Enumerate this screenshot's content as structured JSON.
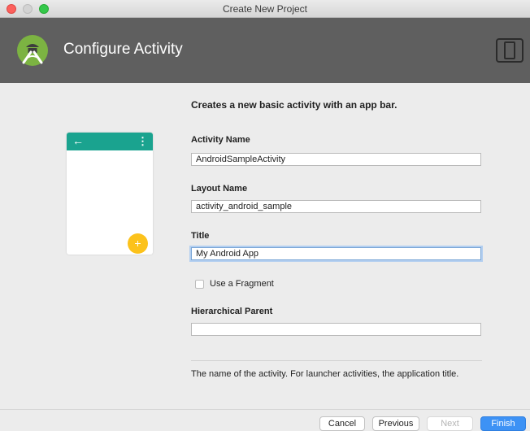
{
  "window": {
    "title": "Create New Project"
  },
  "header": {
    "title": "Configure Activity"
  },
  "description": "Creates a new basic activity with an app bar.",
  "form": {
    "activity_name": {
      "label": "Activity Name",
      "value": "AndroidSampleActivity"
    },
    "layout_name": {
      "label": "Layout Name",
      "value": "activity_android_sample"
    },
    "title": {
      "label": "Title",
      "value": "My Android App"
    },
    "use_fragment": {
      "label": "Use a Fragment",
      "checked": false
    },
    "hierarchical_parent": {
      "label": "Hierarchical Parent",
      "value": ""
    }
  },
  "hint": "The name of the activity. For launcher activities, the application title.",
  "buttons": {
    "cancel": "Cancel",
    "previous": "Previous",
    "next": "Next",
    "finish": "Finish"
  },
  "preview": {
    "back_glyph": "←",
    "menu_glyph": "⋮",
    "fab_glyph": "+"
  },
  "icons": {
    "logo": "android-studio-logo-icon",
    "device": "device-frame-icon"
  },
  "colors": {
    "header_bg": "#5f5f5f",
    "app_bar": "#1aa38f",
    "fab": "#fcc21b",
    "primary_button": "#3d92f5"
  }
}
